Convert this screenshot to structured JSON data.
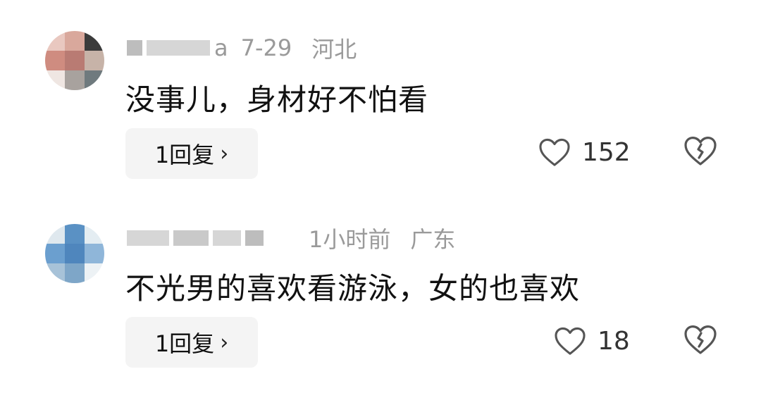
{
  "comments": [
    {
      "username_tail": "a",
      "date": "7-29",
      "location": "河北",
      "text": "没事儿，身材好不怕看",
      "reply_label": "1回复",
      "reply_chevron": "›",
      "likes": "152",
      "like_icon": "heart-outline-icon",
      "dislike_icon": "broken-heart-icon"
    },
    {
      "username_tail": "",
      "date": "1小时前",
      "location": "广东",
      "text": "不光男的喜欢看游泳，女的也喜欢",
      "reply_label": "1回复",
      "reply_chevron": "›",
      "likes": "18",
      "like_icon": "heart-outline-icon",
      "dislike_icon": "broken-heart-icon"
    }
  ],
  "colors": {
    "meta_gray": "#9a9a9a",
    "text_black": "#111111",
    "button_bg": "#f4f4f4",
    "icon_gray": "#555555"
  }
}
